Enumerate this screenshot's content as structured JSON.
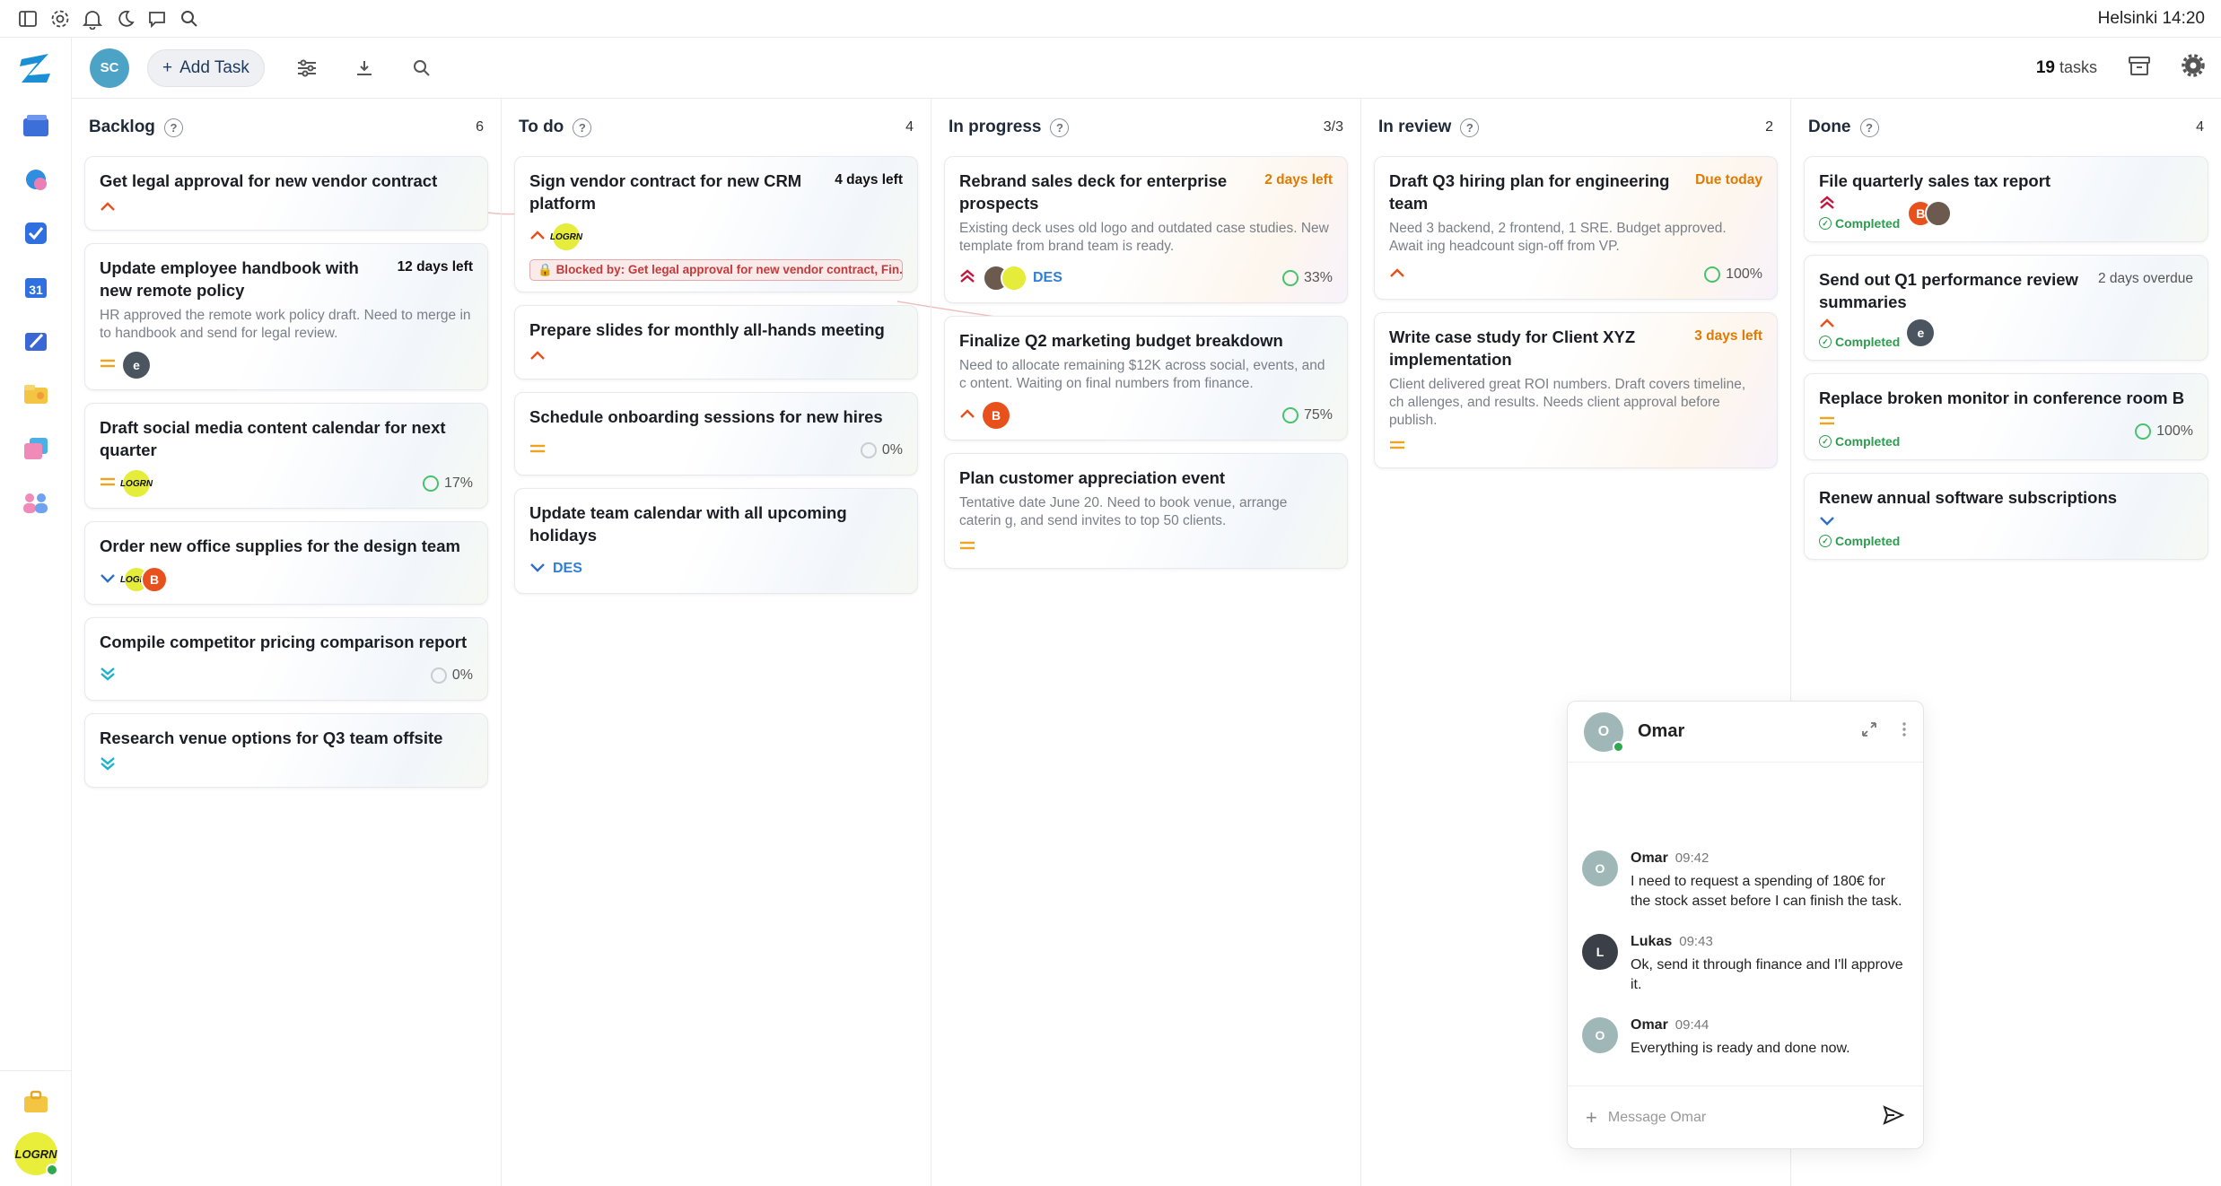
{
  "system_bar": {
    "icons": [
      "sidebar-toggle-icon",
      "gear-icon",
      "bell-icon",
      "moon-icon",
      "chat-bubble-icon",
      "search-icon"
    ],
    "clock": "Helsinki 14:20"
  },
  "rail": {
    "items": [
      "home-icon",
      "inbox-icon",
      "tasks-icon",
      "calendar-icon",
      "notes-icon",
      "folder-icon",
      "docs-icon",
      "team-icon"
    ],
    "calendar_day": "31",
    "user_initials": "LOGRN"
  },
  "toolbar": {
    "user_initials": "SC",
    "add_task_label": "Add Task",
    "count_value": "19",
    "count_label": "tasks"
  },
  "columns": [
    {
      "title": "Backlog",
      "count": "6",
      "cards": [
        {
          "title": "Get legal approval for new vendor contract"
        },
        {
          "title": "Update employee handbook with new remote policy",
          "due": "12 days left",
          "desc": "HR approved the remote work policy draft. Need to merge in to handbook and send for legal review.",
          "avatar": "e"
        },
        {
          "title": "Draft social media content calendar for next quarter",
          "avatar": "LOGRN",
          "pct": "17%"
        },
        {
          "title": "Order new office supplies for the design team",
          "avatars": [
            "LOGRN",
            "B"
          ]
        },
        {
          "title": "Compile competitor pricing comparison report",
          "pct": "0%"
        },
        {
          "title": "Research venue options for Q3 team offsite"
        }
      ]
    },
    {
      "title": "To do",
      "count": "4",
      "cards": [
        {
          "title": "Sign vendor contract for new CRM platform",
          "due": "4 days left",
          "avatar": "LOGRN",
          "blocked": "Blocked by: Get legal approval for new vendor contract, Fin..."
        },
        {
          "title": "Prepare slides for monthly all-hands meeting"
        },
        {
          "title": "Schedule onboarding sessions for new hires",
          "pct": "0%"
        },
        {
          "title": "Update team calendar with all upcoming holidays",
          "tag": "DES"
        }
      ]
    },
    {
      "title": "In progress",
      "count": "3/3",
      "cards": [
        {
          "title": "Rebrand sales deck for enterprise prospects",
          "due": "2 days left",
          "desc": "Existing deck uses old logo and outdated case studies. New template from brand team is ready.",
          "tag": "DES",
          "pct": "33%"
        },
        {
          "title": "Finalize Q2 marketing budget breakdown",
          "desc": "Need to allocate remaining $12K across social, events, and c ontent. Waiting on final numbers from finance.",
          "avatar": "B",
          "pct": "75%"
        },
        {
          "title": "Plan customer appreciation event",
          "desc": "Tentative date June 20. Need to book venue, arrange caterin g, and send invites to top 50 clients."
        }
      ]
    },
    {
      "title": "In review",
      "count": "2",
      "cards": [
        {
          "title": "Draft Q3 hiring plan for engineering team",
          "due": "Due today",
          "desc": "Need 3 backend, 2 frontend, 1 SRE. Budget approved. Await ing headcount sign-off from VP.",
          "pct": "100%"
        },
        {
          "title": "Write case study for Client XYZ implementation",
          "due": "3 days left",
          "desc": "Client delivered great ROI numbers. Draft covers timeline, ch allenges, and results. Needs client approval before publish."
        }
      ]
    },
    {
      "title": "Done",
      "count": "4",
      "cards": [
        {
          "title": "File quarterly sales tax report",
          "status": "Completed",
          "avatars": [
            "B",
            "photo"
          ]
        },
        {
          "title": "Send out Q1 performance review summaries",
          "due": "2 days overdue",
          "status": "Completed",
          "avatar": "e"
        },
        {
          "title": "Replace broken monitor in conference room B",
          "status": "Completed",
          "pct": "100%"
        },
        {
          "title": "Renew annual software subscriptions",
          "status": "Completed"
        }
      ]
    }
  ],
  "chat": {
    "contact": "Omar",
    "messages": [
      {
        "author": "Omar",
        "time": "09:42",
        "text": "I need to request a spending of 180€ for the stock asset before I can finish the task."
      },
      {
        "author": "Lukas",
        "time": "09:43",
        "text": "Ok, send it through finance and I'll approve it."
      },
      {
        "author": "Omar",
        "time": "09:44",
        "text": "Everything is ready and done now."
      }
    ],
    "input_placeholder": "Message Omar"
  },
  "colors": {
    "accent": "#2f7fd6",
    "danger": "#c43a3a",
    "success": "#2d9c4f",
    "warning": "#e07a00"
  }
}
